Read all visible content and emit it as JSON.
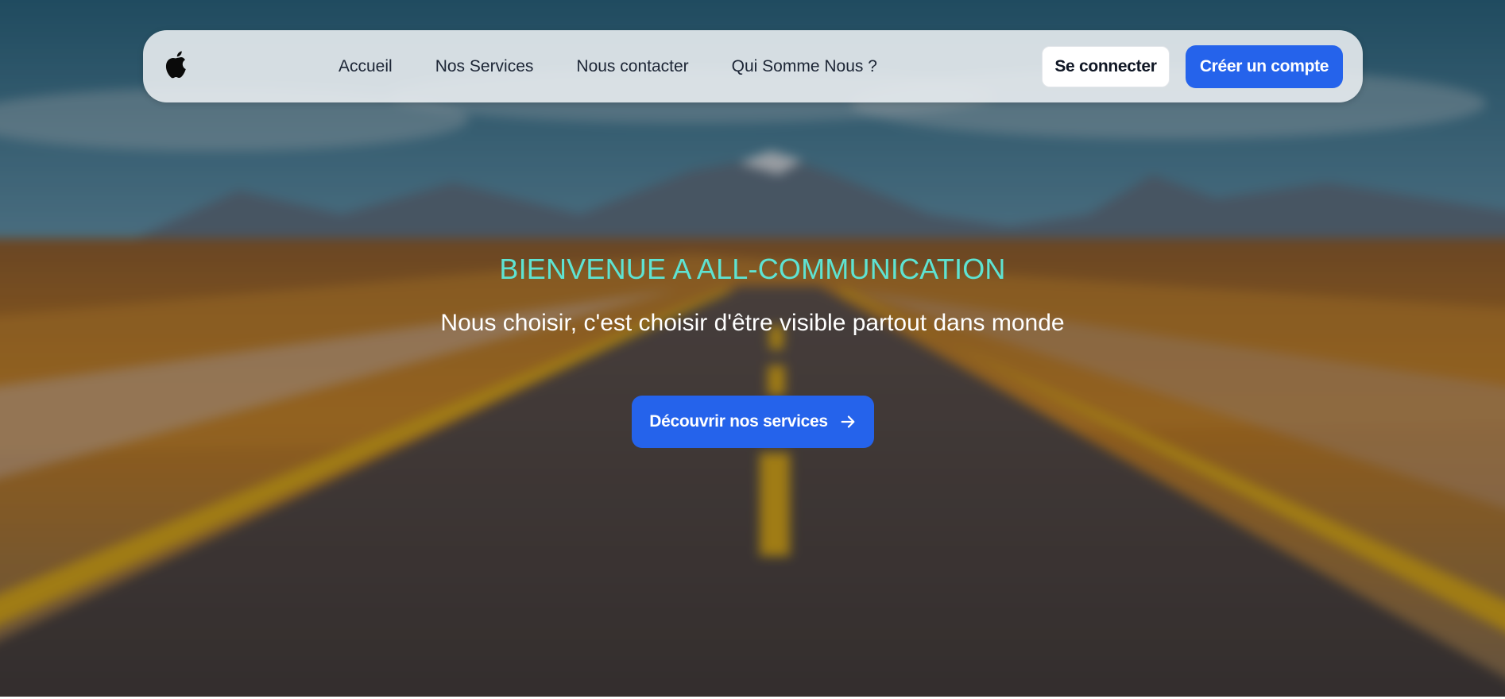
{
  "navbar": {
    "logo_icon": "apple-logo-icon",
    "links": [
      {
        "label": "Accueil"
      },
      {
        "label": "Nos Services"
      },
      {
        "label": "Nous contacter"
      },
      {
        "label": "Qui Somme Nous ?"
      }
    ],
    "login_label": "Se connecter",
    "signup_label": "Créer un compte"
  },
  "hero": {
    "title": "BIENVENUE A ALL-COMMUNICATION",
    "subtitle": "Nous choisir, c'est choisir d'être visible partout dans monde",
    "cta_label": "Découvrir nos services",
    "cta_icon": "arrow-right-icon",
    "background": "blurred desert road with mountains"
  },
  "colors": {
    "accent_blue": "#2563eb",
    "title_teal": "#5ee3d2",
    "navbar_bg": "#e8ecf0",
    "nav_text": "#1c2535"
  }
}
